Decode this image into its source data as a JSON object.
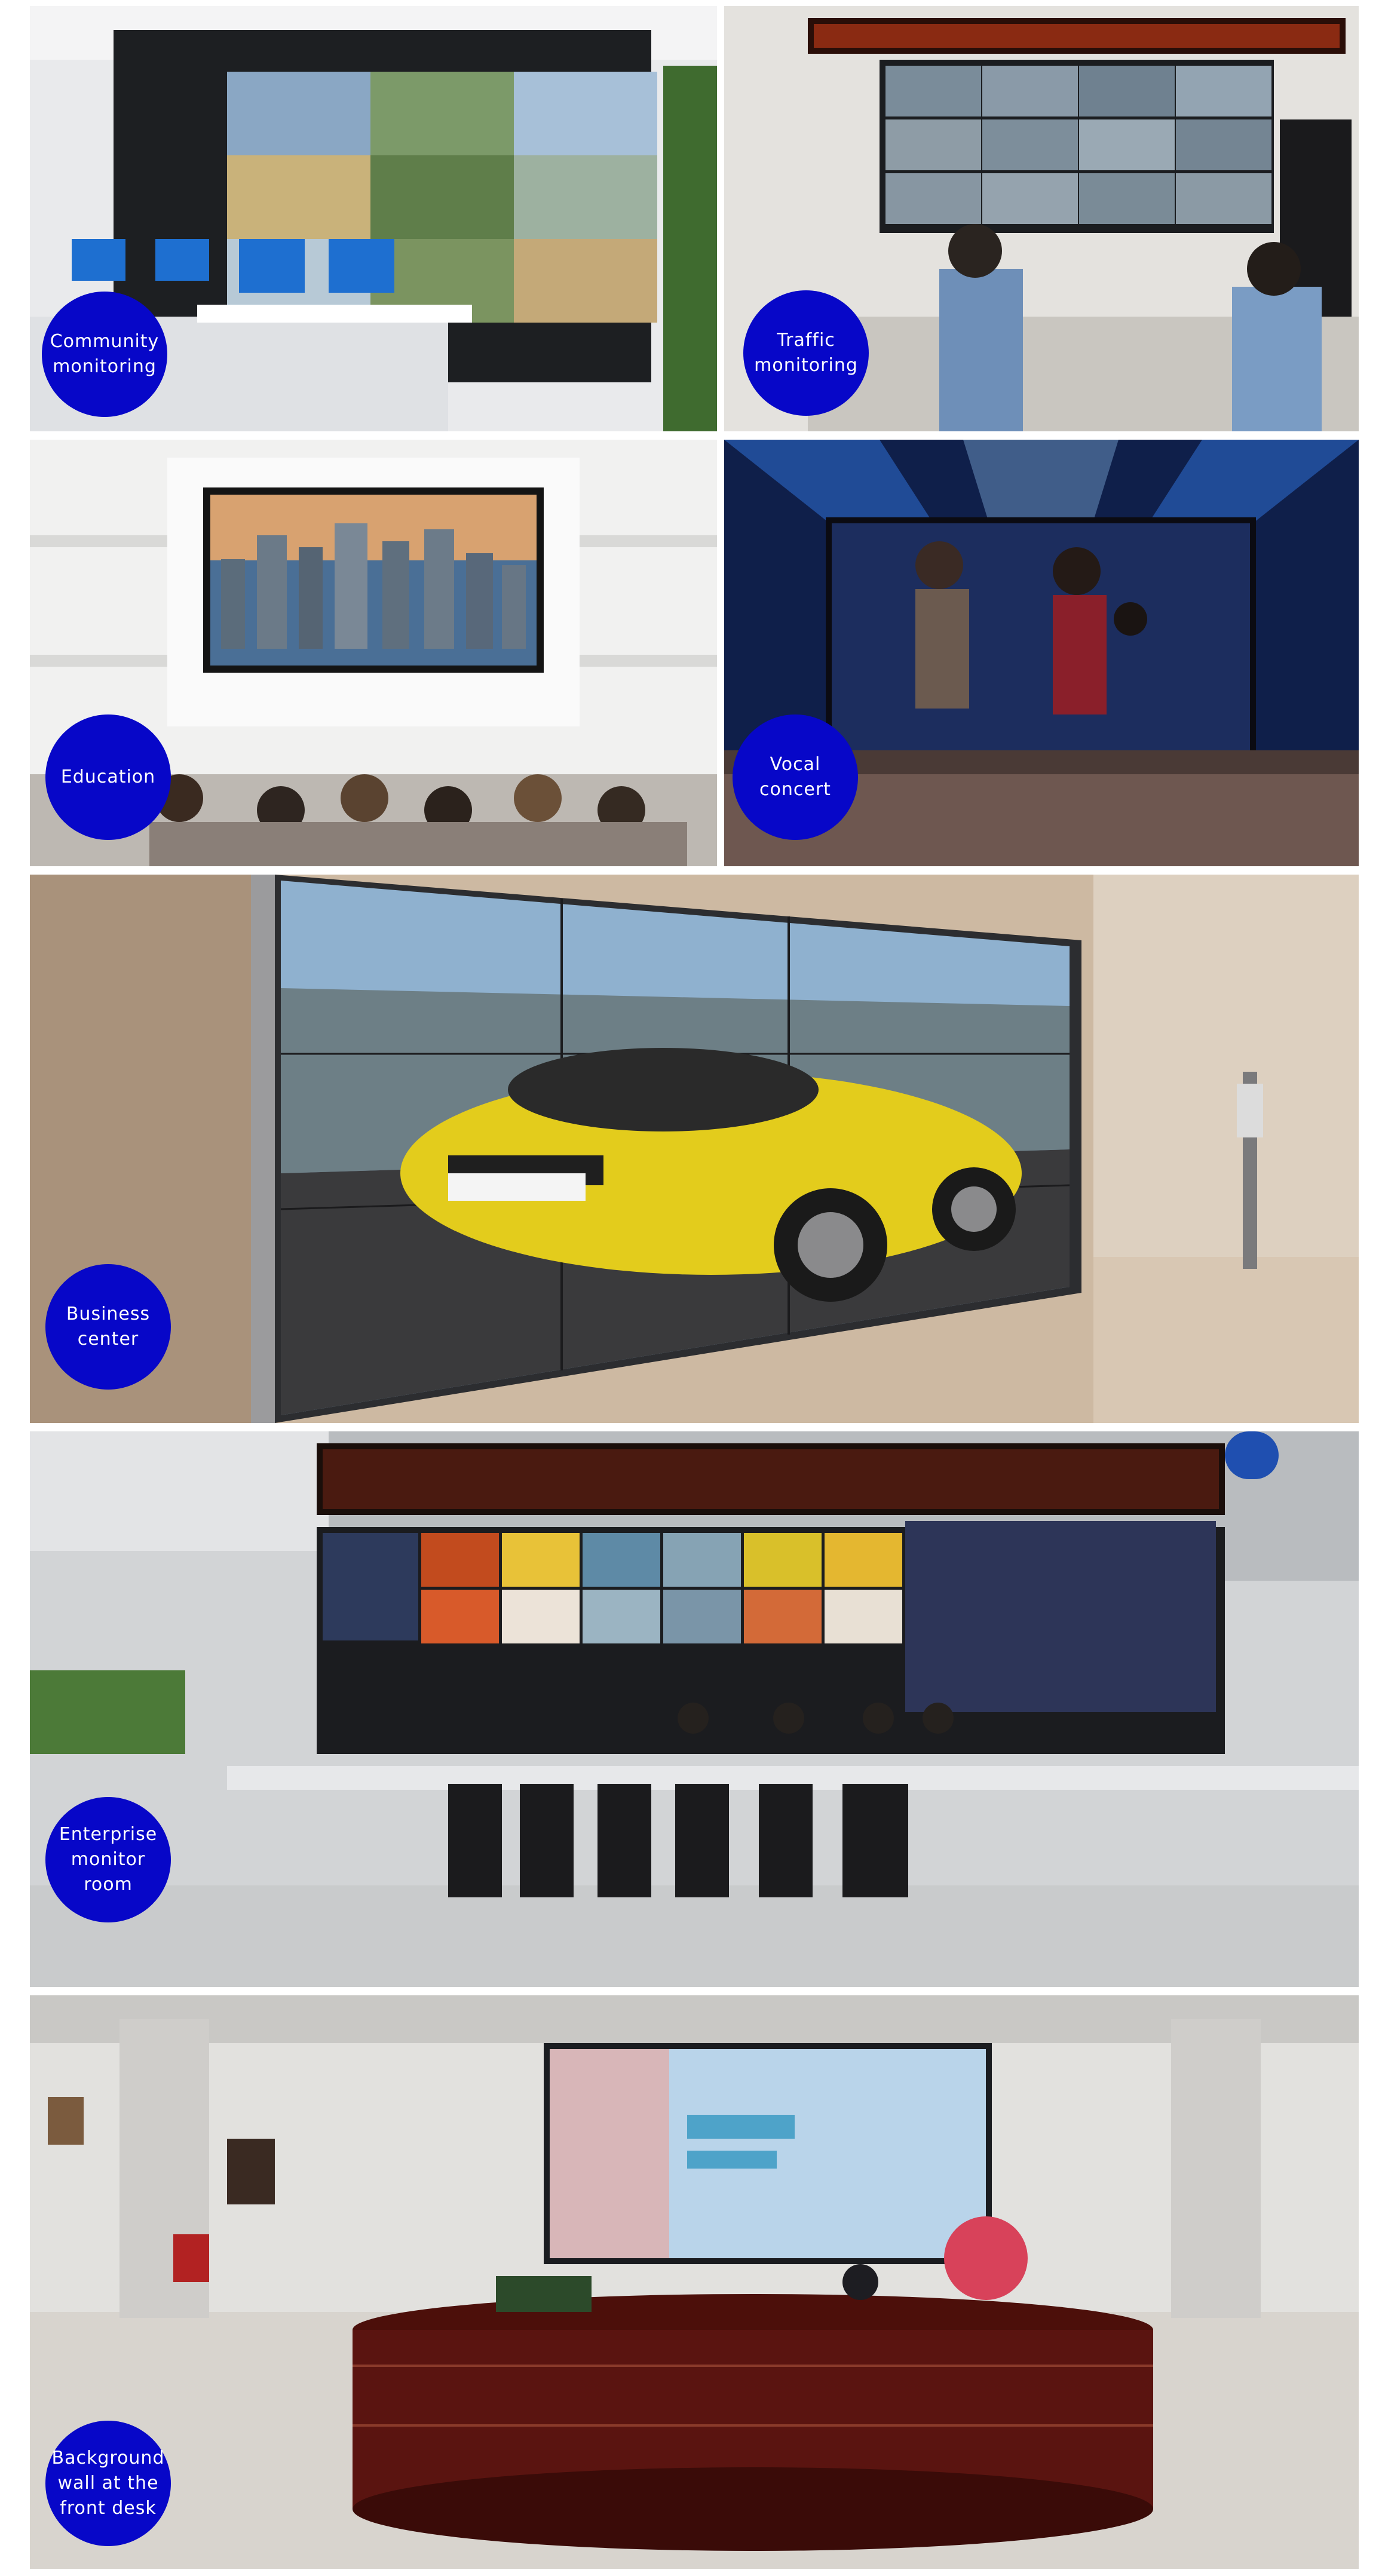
{
  "tiles": [
    {
      "id": "community",
      "label": "Community\nmonitoring"
    },
    {
      "id": "traffic",
      "label": "Traffic\nmonitoring"
    },
    {
      "id": "education",
      "label": "Education"
    },
    {
      "id": "vocal",
      "label": "Vocal\nconcert"
    },
    {
      "id": "business",
      "label": "Business\ncenter"
    },
    {
      "id": "enterprise",
      "label": "Enterprise\nmonitor room"
    },
    {
      "id": "frontdesk",
      "label": "Background\nwall at the\nfront desk"
    }
  ],
  "colors": {
    "badge": "#0707c8",
    "badge_text": "#ffffff"
  }
}
